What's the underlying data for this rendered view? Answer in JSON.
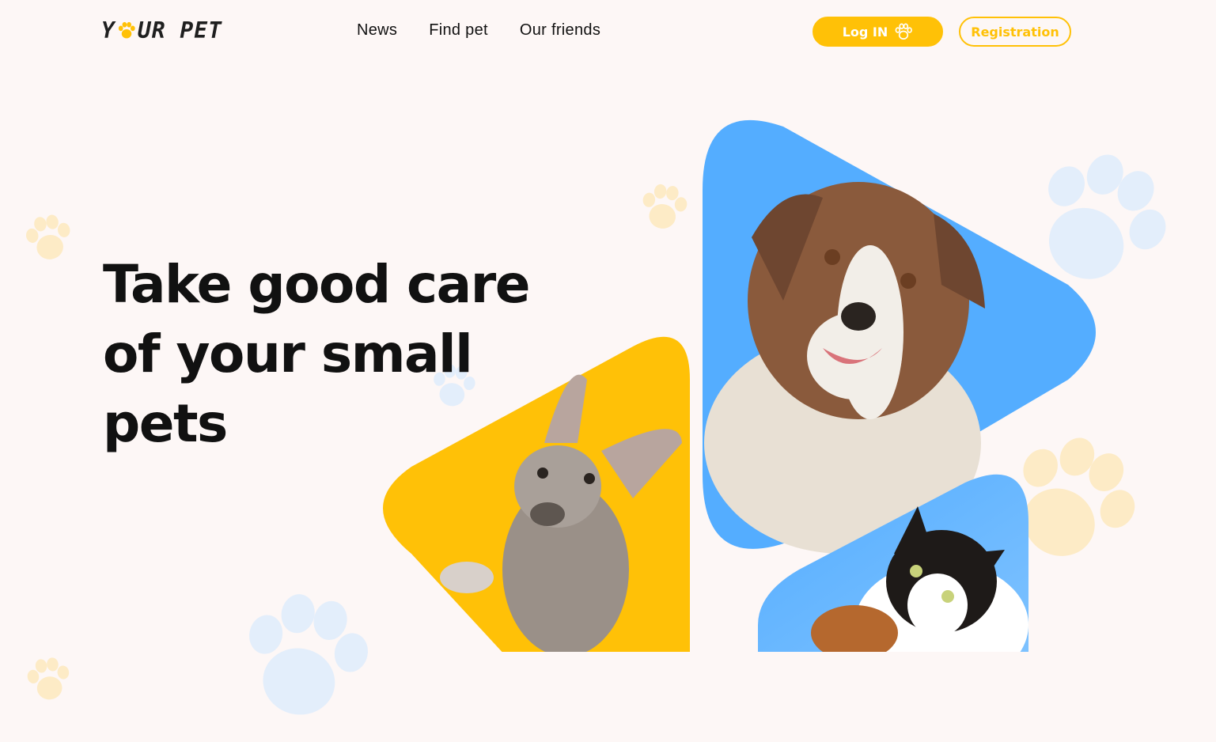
{
  "header": {
    "logo": {
      "text_left": "Y",
      "text_right": "UR PET",
      "icon": "paw-icon"
    },
    "nav": [
      {
        "label": "News"
      },
      {
        "label": "Find pet"
      },
      {
        "label": "Our friends"
      }
    ],
    "login_label": "Log IN",
    "register_label": "Registration"
  },
  "hero": {
    "title": "Take good care of your small pets"
  },
  "images": {
    "dog_large": "dog photo on blue rounded triangle",
    "puppy": "puppy photo on yellow rounded triangle",
    "cat": "cat photo on blue rounded triangle"
  },
  "colors": {
    "accent": "#FFC107",
    "background": "#FDF7F6",
    "blue": "#54ADFF",
    "text": "#111111",
    "paw_blue": "#E3EEFB",
    "paw_yellow": "#FDEBC6"
  }
}
